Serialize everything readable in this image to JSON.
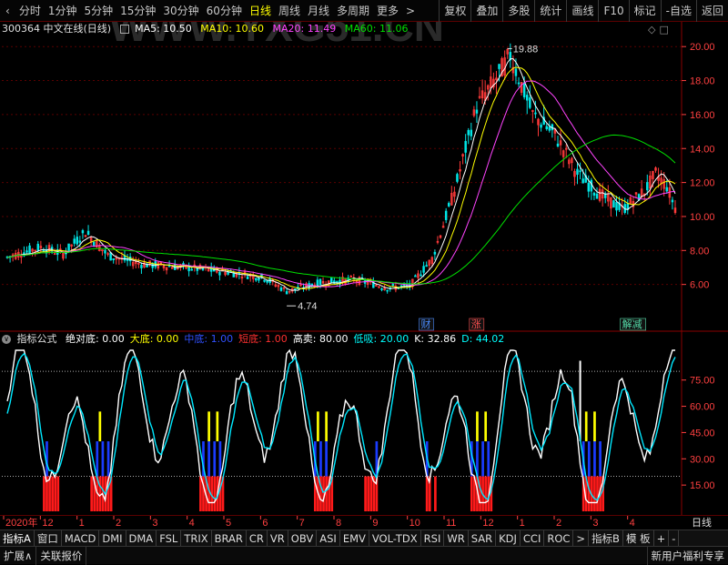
{
  "topbar": {
    "back_icon": "chevron-left-icon",
    "periods": [
      "分时",
      "1分钟",
      "5分钟",
      "15分钟",
      "30分钟",
      "60分钟",
      "日线",
      "周线",
      "月线",
      "多周期",
      "更多"
    ],
    "active_period": "日线",
    "more_arrow": ">",
    "tools": [
      "复权",
      "叠加",
      "多股",
      "统计",
      "画线",
      "F10",
      "标记",
      "-自选",
      "返回"
    ]
  },
  "stock_info": {
    "code_name": "300364 中文在线(日线)",
    "dropdown_icon": "dropdown-square-icon",
    "ma5": "MA5: 10.50",
    "ma10": "MA10: 10.60",
    "ma20": "MA20: 11.49",
    "ma60": "MA60: 11.06",
    "colors": {
      "ma5": "#ffffff",
      "ma10": "#ffff00",
      "ma20": "#ff44ff",
      "ma60": "#00e000"
    }
  },
  "corner_icons": [
    "diamond-icon",
    "square-icon"
  ],
  "watermark": "WWW.YXG51.CN",
  "price_axis": {
    "ticks": [
      "20.00",
      "18.00",
      "16.00",
      "14.00",
      "12.00",
      "10.00",
      "8.00",
      "6.00"
    ],
    "values": [
      20,
      18,
      16,
      14,
      12,
      10,
      8,
      6
    ]
  },
  "price_annotations": {
    "high": "19.88",
    "low": "4.74"
  },
  "event_markers": [
    {
      "label": "财",
      "color": "#4a8cff"
    },
    {
      "label": "涨",
      "color": "#ff5050"
    },
    {
      "label": "解减",
      "color": "#55ddaa"
    }
  ],
  "indicator_info": {
    "title": "指标公式",
    "items": [
      {
        "text": "绝对底: 0.00",
        "color": "#ffffff"
      },
      {
        "text": "大底: 0.00",
        "color": "#ffff00"
      },
      {
        "text": "中底: 1.00",
        "color": "#3050ff"
      },
      {
        "text": "短底: 1.00",
        "color": "#ff3030"
      },
      {
        "text": "高卖: 80.00",
        "color": "#ffffff"
      },
      {
        "text": "低吸: 20.00",
        "color": "#00ffff"
      },
      {
        "text": "K: 32.86",
        "color": "#ffffff"
      },
      {
        "text": "D: 44.02",
        "color": "#00ffff"
      }
    ]
  },
  "indicator_axis": {
    "ticks": [
      "75.00",
      "60.00",
      "45.00",
      "30.00",
      "15.00"
    ],
    "values": [
      75,
      60,
      45,
      30,
      15
    ]
  },
  "time_axis": {
    "labels": [
      "2020年",
      "12",
      "1",
      "2",
      "3",
      "4",
      "5",
      "6",
      "7",
      "8",
      "9",
      "10",
      "11",
      "12",
      "1",
      "2",
      "3",
      "4"
    ],
    "mode": "日线"
  },
  "tabs": [
    "指标A",
    "窗口",
    "MACD",
    "DMI",
    "DMA",
    "FSL",
    "TRIX",
    "BRAR",
    "CR",
    "VR",
    "OBV",
    "ASI",
    "EMV",
    "VOL-TDX",
    "RSI",
    "WR",
    "SAR",
    "KDJ",
    "CCI",
    "ROC",
    ">",
    "指标B",
    "模 板",
    "+",
    "-"
  ],
  "bottombar": {
    "left": [
      "扩展∧",
      "关联报价"
    ],
    "right": "新用户福利专享"
  }
}
